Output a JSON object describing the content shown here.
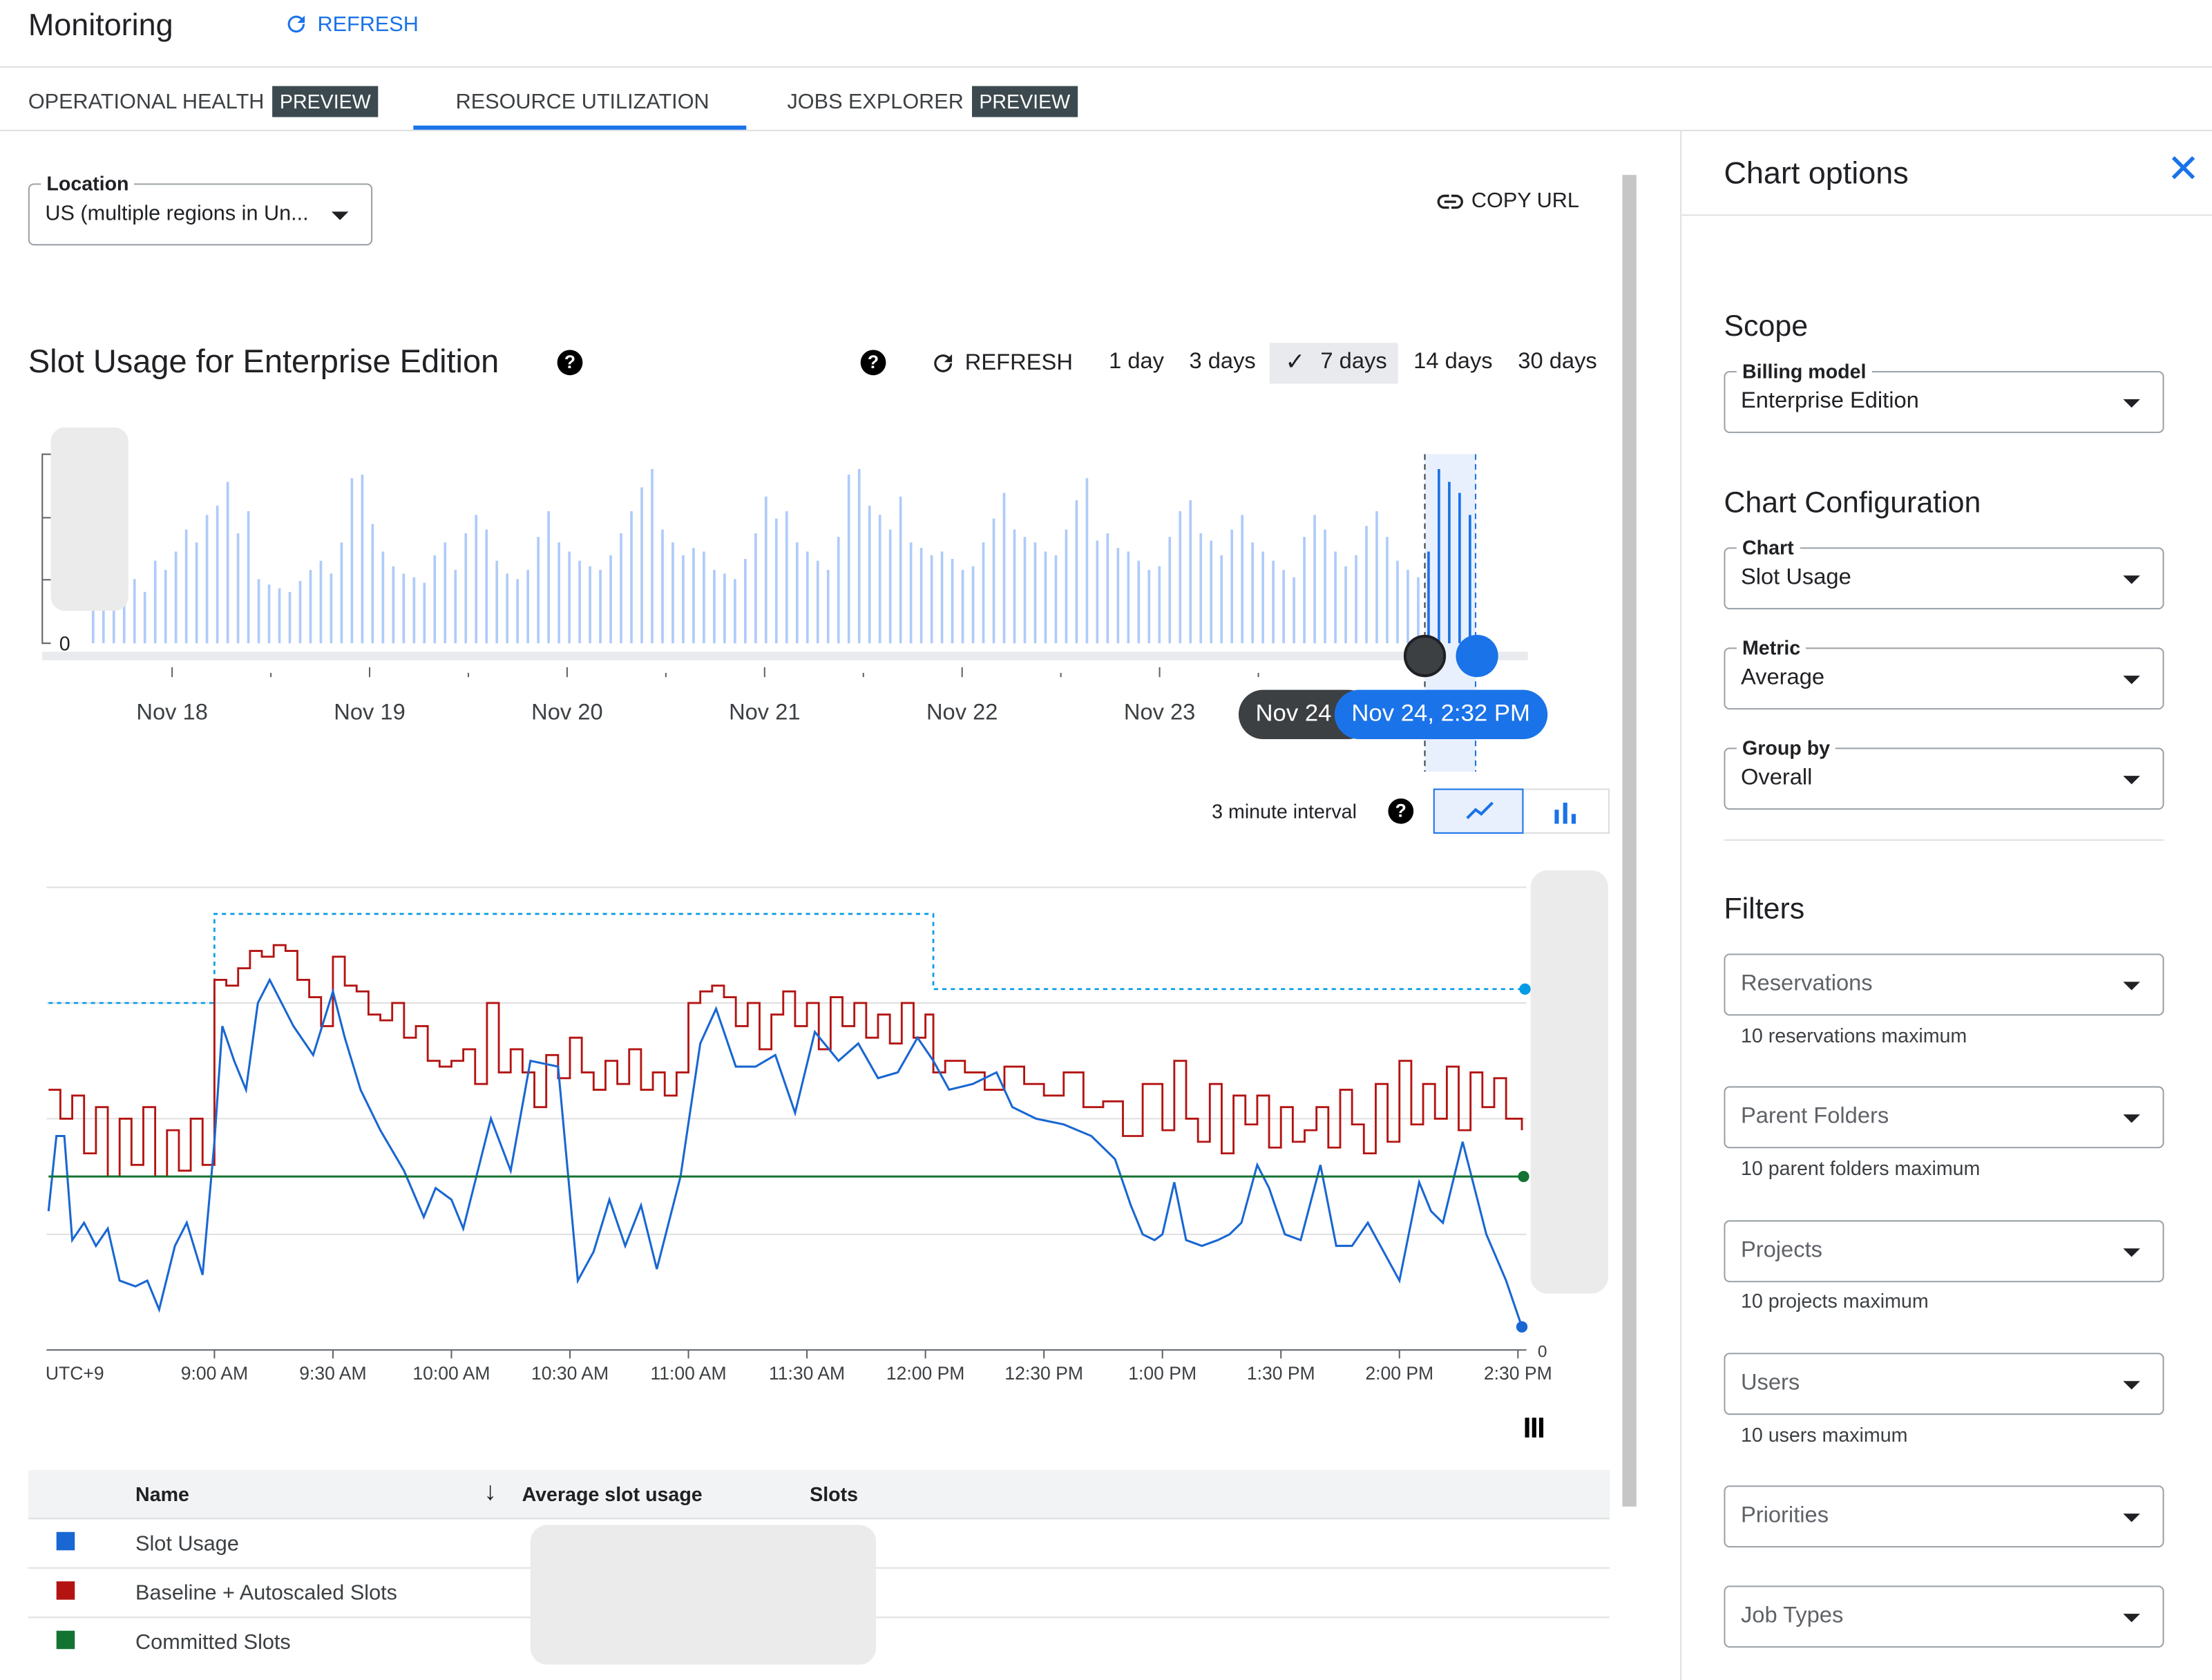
{
  "header": {
    "title": "Monitoring",
    "refresh_label": "REFRESH"
  },
  "tabs": [
    {
      "label": "OPERATIONAL HEALTH",
      "badge": "PREVIEW",
      "active": false
    },
    {
      "label": "RESOURCE UTILIZATION",
      "active": true
    },
    {
      "label": "JOBS EXPLORER",
      "badge": "PREVIEW",
      "active": false
    }
  ],
  "location": {
    "label": "Location",
    "value": "US (multiple regions in Un..."
  },
  "copy_url_label": "COPY URL",
  "chart_panel": {
    "title": "Slot Usage for Enterprise Edition",
    "refresh_label": "REFRESH",
    "ranges": [
      "1 day",
      "3 days",
      "7 days",
      "14 days",
      "30 days"
    ],
    "selected_range": "7 days",
    "interval_label": "3 minute interval"
  },
  "colors": {
    "accent": "#1a73e8",
    "slot_usage": "#1967d2",
    "baseline": "#b31412",
    "committed": "#137333",
    "overview_bar": "#aecbfa"
  },
  "chart_data": [
    {
      "type": "bar",
      "role": "overview timeline",
      "tick_labels": [
        "Nov 18",
        "Nov 19",
        "Nov 20",
        "Nov 21",
        "Nov 22",
        "Nov 23",
        "Nov 24"
      ],
      "y_tick_labels": [
        "0"
      ],
      "selection": {
        "start": "Nov 24",
        "end": "Nov 24, 2:32 PM"
      },
      "values": [
        22,
        25,
        20,
        30,
        35,
        28,
        45,
        40,
        50,
        62,
        55,
        70,
        75,
        88,
        60,
        72,
        35,
        32,
        30,
        28,
        34,
        40,
        45,
        38,
        55,
        90,
        92,
        65,
        50,
        42,
        38,
        36,
        33,
        48,
        55,
        40,
        60,
        70,
        62,
        45,
        38,
        35,
        40,
        58,
        72,
        55,
        50,
        45,
        42,
        40,
        48,
        60,
        72,
        85,
        95,
        62,
        55,
        48,
        52,
        50,
        40,
        38,
        35,
        46,
        60,
        80,
        68,
        72,
        55,
        50,
        45,
        40,
        58,
        92,
        95,
        75,
        70,
        62,
        80,
        55,
        52,
        48,
        50,
        46,
        40,
        42,
        55,
        68,
        82,
        62,
        58,
        55,
        50,
        48,
        62,
        78,
        90,
        56,
        60,
        52,
        50,
        45,
        40,
        42,
        58,
        72,
        78,
        60,
        56,
        48,
        62,
        70,
        55,
        50,
        45,
        40,
        36,
        58,
        70,
        62,
        50,
        42,
        48,
        64,
        72,
        58,
        45,
        40,
        36,
        50,
        95,
        88,
        82,
        70
      ]
    },
    {
      "type": "line",
      "role": "slot usage detail",
      "x_tick_labels": [
        "UTC+9",
        "9:00 AM",
        "9:30 AM",
        "10:00 AM",
        "10:30 AM",
        "11:00 AM",
        "11:30 AM",
        "12:00 PM",
        "12:30 PM",
        "1:00 PM",
        "1:30 PM",
        "2:00 PM",
        "2:30 PM"
      ],
      "y_tick_labels": [
        "0"
      ],
      "ylim": [
        0,
        400
      ],
      "grid": true,
      "series": [
        {
          "name": "Slot Usage",
          "color": "#1967d2",
          "x": [
            "8:18",
            "8:20",
            "8:22",
            "8:24",
            "8:27",
            "8:30",
            "8:33",
            "8:36",
            "8:40",
            "8:43",
            "8:46",
            "8:50",
            "8:53",
            "8:57",
            "9:00",
            "9:02",
            "9:05",
            "9:08",
            "9:11",
            "9:14",
            "9:17",
            "9:20",
            "9:25",
            "9:30",
            "9:33",
            "9:37",
            "9:42",
            "9:48",
            "9:53",
            "9:56",
            "10:00",
            "10:03",
            "10:10",
            "10:15",
            "10:20",
            "10:27",
            "10:32",
            "10:36",
            "10:40",
            "10:44",
            "10:48",
            "10:52",
            "10:58",
            "11:03",
            "11:07",
            "11:12",
            "11:17",
            "11:22",
            "11:27",
            "11:32",
            "11:38",
            "11:43",
            "11:48",
            "11:53",
            "11:58",
            "12:02",
            "12:06",
            "12:12",
            "12:18",
            "12:22",
            "12:28",
            "12:35",
            "12:42",
            "12:48",
            "12:52",
            "12:55",
            "12:58",
            "13:00",
            "13:03",
            "13:06",
            "13:10",
            "13:14",
            "13:17",
            "13:20",
            "13:24",
            "13:27",
            "13:31",
            "13:35",
            "13:40",
            "13:44",
            "13:48",
            "13:52",
            "13:56",
            "14:00",
            "14:05",
            "14:08",
            "14:11",
            "14:16",
            "14:22",
            "14:27",
            "14:31"
          ],
          "values": [
            120,
            185,
            185,
            95,
            110,
            90,
            105,
            60,
            55,
            60,
            35,
            90,
            110,
            65,
            180,
            280,
            250,
            225,
            300,
            320,
            300,
            280,
            255,
            310,
            270,
            225,
            190,
            155,
            115,
            140,
            130,
            105,
            200,
            155,
            250,
            245,
            60,
            85,
            130,
            90,
            125,
            70,
            150,
            265,
            295,
            245,
            245,
            255,
            205,
            275,
            250,
            265,
            235,
            240,
            270,
            250,
            225,
            230,
            240,
            210,
            200,
            195,
            185,
            165,
            125,
            100,
            95,
            100,
            145,
            95,
            90,
            95,
            100,
            110,
            160,
            140,
            100,
            95,
            160,
            90,
            90,
            110,
            85,
            60,
            145,
            120,
            110,
            180,
            100,
            60,
            20
          ]
        },
        {
          "name": "Baseline + Autoscaled Slots",
          "color": "#b31412",
          "x": [
            "8:18",
            "8:21",
            "8:24",
            "8:27",
            "8:30",
            "8:33",
            "8:36",
            "8:39",
            "8:42",
            "8:45",
            "8:48",
            "8:51",
            "8:54",
            "8:57",
            "9:00",
            "9:03",
            "9:06",
            "9:09",
            "9:12",
            "9:15",
            "9:18",
            "9:21",
            "9:24",
            "9:27",
            "9:30",
            "9:33",
            "9:36",
            "9:39",
            "9:42",
            "9:45",
            "9:48",
            "9:51",
            "9:54",
            "9:57",
            "10:00",
            "10:03",
            "10:06",
            "10:09",
            "10:12",
            "10:15",
            "10:18",
            "10:21",
            "10:24",
            "10:27",
            "10:30",
            "10:33",
            "10:36",
            "10:39",
            "10:42",
            "10:45",
            "10:48",
            "10:51",
            "10:54",
            "10:57",
            "11:00",
            "11:03",
            "11:06",
            "11:09",
            "11:12",
            "11:15",
            "11:18",
            "11:21",
            "11:24",
            "11:27",
            "11:30",
            "11:33",
            "11:36",
            "11:39",
            "11:42",
            "11:45",
            "11:48",
            "11:51",
            "11:54",
            "11:57",
            "12:00",
            "12:02",
            "12:05",
            "12:10",
            "12:15",
            "12:20",
            "12:25",
            "12:30",
            "12:35",
            "12:40",
            "12:45",
            "12:50",
            "12:55",
            "13:00",
            "13:03",
            "13:06",
            "13:09",
            "13:12",
            "13:15",
            "13:18",
            "13:21",
            "13:24",
            "13:27",
            "13:30",
            "13:33",
            "13:36",
            "13:39",
            "13:42",
            "13:45",
            "13:48",
            "13:51",
            "13:54",
            "13:57",
            "14:00",
            "14:03",
            "14:06",
            "14:09",
            "14:12",
            "14:15",
            "14:18",
            "14:21",
            "14:24",
            "14:27",
            "14:31"
          ],
          "values": [
            225,
            200,
            220,
            170,
            210,
            150,
            200,
            160,
            210,
            150,
            190,
            155,
            200,
            160,
            320,
            315,
            330,
            345,
            340,
            350,
            345,
            320,
            305,
            280,
            340,
            315,
            310,
            290,
            285,
            300,
            270,
            280,
            250,
            245,
            250,
            260,
            230,
            300,
            240,
            260,
            240,
            210,
            255,
            235,
            270,
            240,
            225,
            250,
            230,
            260,
            225,
            240,
            220,
            240,
            300,
            310,
            315,
            305,
            280,
            300,
            260,
            290,
            310,
            280,
            300,
            260,
            305,
            280,
            300,
            270,
            290,
            265,
            300,
            270,
            290,
            240,
            250,
            240,
            225,
            245,
            230,
            220,
            240,
            210,
            215,
            185,
            230,
            190,
            250,
            200,
            180,
            230,
            170,
            220,
            195,
            220,
            175,
            210,
            180,
            190,
            210,
            175,
            225,
            195,
            170,
            230,
            180,
            250,
            195,
            230,
            200,
            245,
            190,
            240,
            210,
            235,
            200,
            190
          ]
        },
        {
          "name": "Committed Slots",
          "color": "#137333",
          "x": [
            "8:18",
            "14:32"
          ],
          "values": [
            150,
            150
          ]
        }
      ],
      "baseline_reference": {
        "x": [
          "8:18",
          "9:00",
          "9:00",
          "12:02",
          "12:02",
          "14:32"
        ],
        "values": [
          300,
          300,
          377,
          377,
          312,
          312
        ]
      }
    }
  ],
  "legend_table": {
    "columns": [
      "Name",
      "Average slot usage",
      "Slots"
    ],
    "rows": [
      {
        "name": "Slot Usage",
        "color": "#1967d2"
      },
      {
        "name": "Baseline + Autoscaled Slots",
        "color": "#b31412"
      },
      {
        "name": "Committed Slots",
        "color": "#137333"
      }
    ]
  },
  "options": {
    "title": "Chart options",
    "scope_heading": "Scope",
    "billing_model": {
      "label": "Billing model",
      "value": "Enterprise Edition"
    },
    "config_heading": "Chart Configuration",
    "chart": {
      "label": "Chart",
      "value": "Slot Usage"
    },
    "metric": {
      "label": "Metric",
      "value": "Average"
    },
    "group_by": {
      "label": "Group by",
      "value": "Overall"
    },
    "filters_heading": "Filters",
    "filters": [
      {
        "placeholder": "Reservations",
        "hint": "10 reservations maximum"
      },
      {
        "placeholder": "Parent Folders",
        "hint": "10 parent folders maximum"
      },
      {
        "placeholder": "Projects",
        "hint": "10 projects maximum"
      },
      {
        "placeholder": "Users",
        "hint": "10 users maximum"
      },
      {
        "placeholder": "Priorities"
      },
      {
        "placeholder": "Job Types"
      }
    ]
  }
}
